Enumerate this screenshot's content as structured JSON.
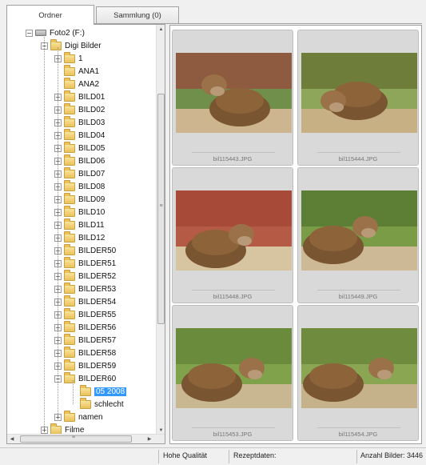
{
  "tabs": [
    {
      "label": "Ordner",
      "active": true
    },
    {
      "label": "Sammlung (0)",
      "active": false
    }
  ],
  "tree": {
    "root": {
      "label": "Foto2 (F:)",
      "expander": "−"
    },
    "digi": {
      "label": "Digi Bilder",
      "expander": "−"
    },
    "items": [
      {
        "label": "1",
        "expander": "+"
      },
      {
        "label": "ANA1",
        "expander": ""
      },
      {
        "label": "ANA2",
        "expander": ""
      },
      {
        "label": "BILD01",
        "expander": "+"
      },
      {
        "label": "BILD02",
        "expander": "+"
      },
      {
        "label": "BILD03",
        "expander": "+"
      },
      {
        "label": "BILD04",
        "expander": "+"
      },
      {
        "label": "BILD05",
        "expander": "+"
      },
      {
        "label": "BILD06",
        "expander": "+"
      },
      {
        "label": "BILD07",
        "expander": "+"
      },
      {
        "label": "BILD08",
        "expander": "+"
      },
      {
        "label": "BILD09",
        "expander": "+"
      },
      {
        "label": "BILD10",
        "expander": "+"
      },
      {
        "label": "BILD11",
        "expander": "+"
      },
      {
        "label": "BILD12",
        "expander": "+"
      },
      {
        "label": "BILDER50",
        "expander": "+"
      },
      {
        "label": "BILDER51",
        "expander": "+"
      },
      {
        "label": "BILDER52",
        "expander": "+"
      },
      {
        "label": "BILDER53",
        "expander": "+"
      },
      {
        "label": "BILDER54",
        "expander": "+"
      },
      {
        "label": "BILDER55",
        "expander": "+"
      },
      {
        "label": "BILDER56",
        "expander": "+"
      },
      {
        "label": "BILDER57",
        "expander": "+"
      },
      {
        "label": "BILDER58",
        "expander": "+"
      },
      {
        "label": "BILDER59",
        "expander": "+"
      },
      {
        "label": "BILDER60",
        "expander": "−"
      }
    ],
    "sub": [
      {
        "label": "05 2008",
        "selected": true
      },
      {
        "label": "schlecht",
        "selected": false
      }
    ],
    "namen": {
      "label": "namen",
      "expander": "+"
    },
    "filme": {
      "label": "Filme",
      "expander": "+"
    }
  },
  "thumbnails": [
    {
      "file": "bil115443.JPG"
    },
    {
      "file": "bil115444.JPG"
    },
    {
      "file": "bil115448.JPG"
    },
    {
      "file": "bil115449.JPG"
    },
    {
      "file": "bil115453.JPG"
    },
    {
      "file": "bil115454.JPG"
    }
  ],
  "status": {
    "quality": "Hohe Qualität",
    "recipe": "Rezeptdaten:",
    "count": "Anzahl Bilder: 3446"
  },
  "icons": {
    "folder": "folder-icon",
    "drive": "drive-icon",
    "scroll_up": "▲",
    "scroll_down": "▼",
    "scroll_left": "◀",
    "scroll_right": "▶",
    "grip": "≡"
  }
}
